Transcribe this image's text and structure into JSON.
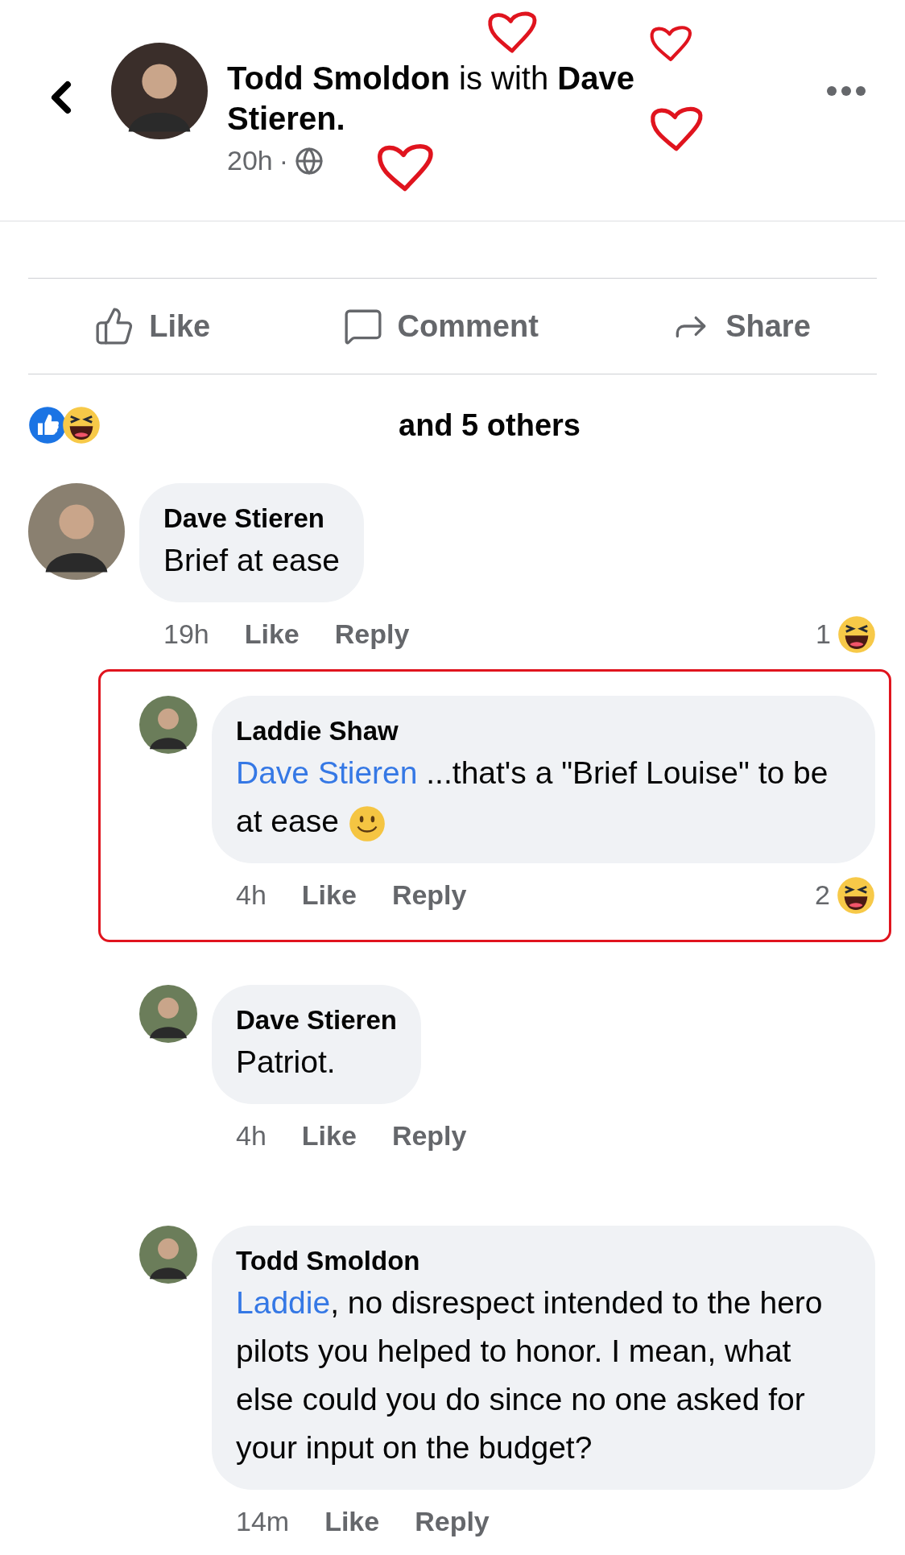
{
  "header": {
    "title": "**Todd Smoldon** is with **Dave Stieren.**",
    "time": "20h",
    "separator": "·"
  },
  "actions": [
    {
      "kind": "like",
      "label": "Like"
    },
    {
      "kind": "comment",
      "label": "Comment"
    },
    {
      "kind": "share",
      "label": "Share"
    }
  ],
  "reactions": {
    "summary": "and 5 others"
  },
  "comments": [
    {
      "name": "Dave Stieren",
      "body": "Brief at ease",
      "time": "19h",
      "like": "Like",
      "reply": "Reply",
      "reaction_count": "1",
      "children": [
        {
          "name": "Laddie Shaw",
          "mention": "Dave Stieren",
          "body": " ...that's a \"Brief Louise\" to be at ease",
          "smiley": true,
          "time": "4h",
          "like": "Like",
          "reply": "Reply",
          "reaction_count": "2",
          "highlighted": true
        },
        {
          "name": "Dave Stieren",
          "body": "Patriot.",
          "time": "4h",
          "like": "Like",
          "reply": "Reply",
          "highlighted": false
        },
        {
          "name": "Todd Smoldon",
          "mention": "Laddie",
          "body": ", no disrespect intended to the hero pilots you helped to honor. I mean, what else could you do since no one asked for your input on the budget?",
          "time": "14m",
          "like": "Like",
          "reply": "Reply",
          "highlighted": false
        }
      ]
    }
  ]
}
